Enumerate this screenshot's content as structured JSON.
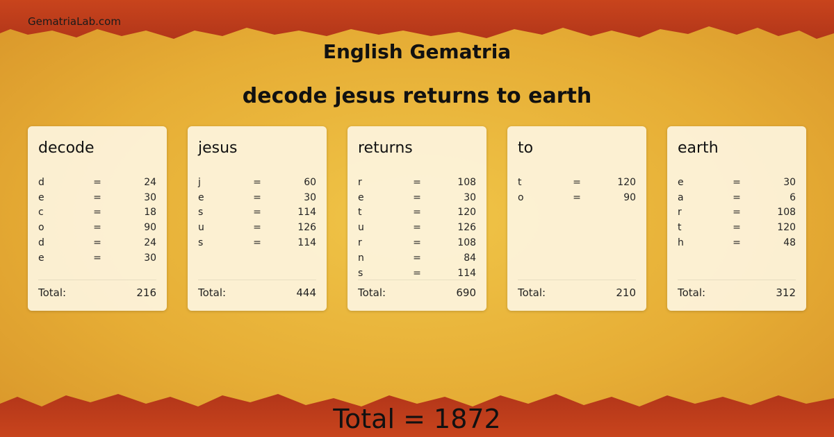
{
  "site": {
    "name": "GematriaLab.com"
  },
  "header": {
    "title": "English Gematria",
    "phrase": "decode jesus returns to earth"
  },
  "words": [
    {
      "word": "decode",
      "rows": [
        {
          "letter": "d",
          "eq": "=",
          "value": "24"
        },
        {
          "letter": "e",
          "eq": "=",
          "value": "30"
        },
        {
          "letter": "c",
          "eq": "=",
          "value": "18"
        },
        {
          "letter": "o",
          "eq": "=",
          "value": "90"
        },
        {
          "letter": "d",
          "eq": "=",
          "value": "24"
        },
        {
          "letter": "e",
          "eq": "=",
          "value": "30"
        }
      ],
      "total_label": "Total:",
      "total": "216"
    },
    {
      "word": "jesus",
      "rows": [
        {
          "letter": "j",
          "eq": "=",
          "value": "60"
        },
        {
          "letter": "e",
          "eq": "=",
          "value": "30"
        },
        {
          "letter": "s",
          "eq": "=",
          "value": "114"
        },
        {
          "letter": "u",
          "eq": "=",
          "value": "126"
        },
        {
          "letter": "s",
          "eq": "=",
          "value": "114"
        }
      ],
      "total_label": "Total:",
      "total": "444"
    },
    {
      "word": "returns",
      "rows": [
        {
          "letter": "r",
          "eq": "=",
          "value": "108"
        },
        {
          "letter": "e",
          "eq": "=",
          "value": "30"
        },
        {
          "letter": "t",
          "eq": "=",
          "value": "120"
        },
        {
          "letter": "u",
          "eq": "=",
          "value": "126"
        },
        {
          "letter": "r",
          "eq": "=",
          "value": "108"
        },
        {
          "letter": "n",
          "eq": "=",
          "value": "84"
        },
        {
          "letter": "s",
          "eq": "=",
          "value": "114"
        }
      ],
      "total_label": "Total:",
      "total": "690"
    },
    {
      "word": "to",
      "rows": [
        {
          "letter": "t",
          "eq": "=",
          "value": "120"
        },
        {
          "letter": "o",
          "eq": "=",
          "value": "90"
        }
      ],
      "total_label": "Total:",
      "total": "210"
    },
    {
      "word": "earth",
      "rows": [
        {
          "letter": "e",
          "eq": "=",
          "value": "30"
        },
        {
          "letter": "a",
          "eq": "=",
          "value": "6"
        },
        {
          "letter": "r",
          "eq": "=",
          "value": "108"
        },
        {
          "letter": "t",
          "eq": "=",
          "value": "120"
        },
        {
          "letter": "h",
          "eq": "=",
          "value": "48"
        }
      ],
      "total_label": "Total:",
      "total": "312"
    }
  ],
  "grand_total": {
    "text": "Total = 1872"
  },
  "colors": {
    "border_red": "#c1401b",
    "parchment": "#e2a530",
    "card_bg": "#fdf4de"
  }
}
